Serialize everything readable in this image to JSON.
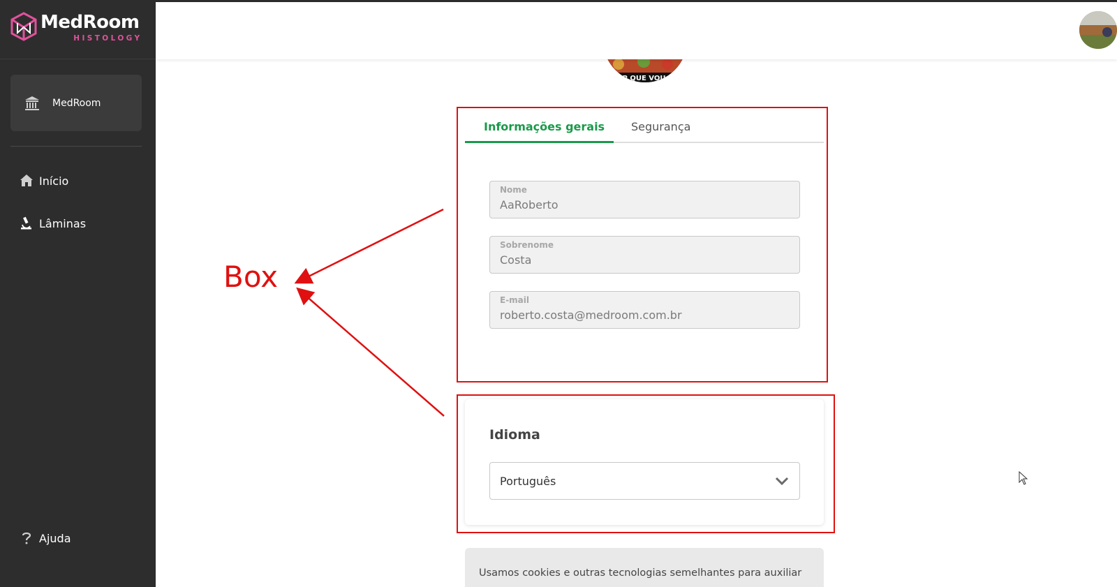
{
  "app": {
    "brand_name": "MedRoom",
    "brand_subtitle": "HISTOLOGY"
  },
  "sidebar": {
    "org_card": {
      "label": "MedRoom",
      "icon": "institution-icon"
    },
    "nav": [
      {
        "label": "Início",
        "icon": "home-icon"
      },
      {
        "label": "Lâminas",
        "icon": "microscope-icon"
      }
    ],
    "help": {
      "label": "Ajuda",
      "icon": "question-icon"
    }
  },
  "profile": {
    "photo_caption": "XUP QUE VOU FO"
  },
  "tabs": [
    {
      "label": "Informações gerais",
      "active": true
    },
    {
      "label": "Segurança",
      "active": false
    }
  ],
  "form": {
    "nome": {
      "label": "Nome",
      "value": "AaRoberto"
    },
    "sobrenome": {
      "label": "Sobrenome",
      "value": "Costa"
    },
    "email": {
      "label": "E-mail",
      "value": "roberto.costa@medroom.com.br"
    }
  },
  "language": {
    "title": "Idioma",
    "selected": "Português"
  },
  "cookie_banner": {
    "text": "Usamos cookies e outras tecnologias semelhantes para auxiliar na"
  },
  "annotation": {
    "label": "Box",
    "color": "#e01010"
  },
  "colors": {
    "accent_green": "#1a9a4a",
    "brand_pink": "#e0529b",
    "sidebar_bg": "#2d2d2d"
  }
}
